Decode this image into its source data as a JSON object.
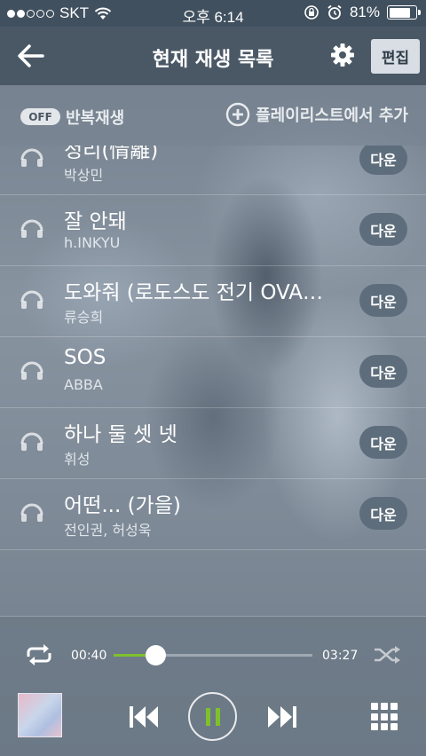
{
  "status_bar": {
    "carrier": "SKT",
    "time": "오후 6:14",
    "battery": "81%",
    "battery_level": 0.81,
    "signal_dots_on": 2,
    "signal_dots_total": 5
  },
  "header": {
    "title": "현재 재생 목록",
    "edit_label": "편집"
  },
  "repeat_bar": {
    "toggle_label": "OFF",
    "repeat_label": "반복재생",
    "add_playlist_label": "플레이리스트에서 추가"
  },
  "songs": [
    {
      "title": "정리(情離)",
      "artist": "박상민",
      "button": "다운"
    },
    {
      "title": "잘 안돼",
      "artist": "h.INKYU",
      "button": "다운"
    },
    {
      "title": "도와줘 (로도스도 전기 OVA…",
      "artist": "류승희",
      "button": "다운"
    },
    {
      "title": "SOS",
      "artist": "ABBA",
      "button": "다운"
    },
    {
      "title": "하나 둘 셋 넷",
      "artist": "휘성",
      "button": "다운"
    },
    {
      "title": "어떤... (가을)",
      "artist": "전인권, 허성욱",
      "button": "다운"
    }
  ],
  "player": {
    "elapsed": "00:40",
    "total": "03:27",
    "progress": 0.21
  },
  "colors": {
    "accent": "#7fc12d",
    "header_bg": "#4a5866"
  },
  "icons": {
    "back": "arrow-left-icon",
    "settings": "gear-icon",
    "add": "plus-circle-icon",
    "song": "music-note-icon",
    "repeat": "repeat-icon",
    "shuffle": "shuffle-icon",
    "prev": "skip-previous-icon",
    "pause": "pause-icon",
    "next": "skip-next-icon",
    "menu": "grid-menu-icon"
  }
}
